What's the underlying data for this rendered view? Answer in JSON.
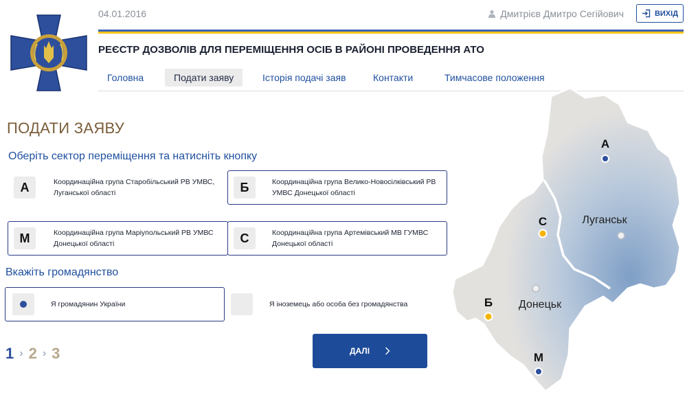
{
  "header": {
    "date": "04.01.2016",
    "user_name": "Дмитрієв Дмитро Сегійович",
    "logout_label": "ВИХІД",
    "registry_title": "РЕЄСТР ДОЗВОЛІВ ДЛЯ ПЕРЕМІЩЕННЯ ОСІБ В РАЙОНІ ПРОВЕДЕННЯ АТО"
  },
  "nav": {
    "items": [
      {
        "label": "Головна",
        "active": false
      },
      {
        "label": "Подати заяву",
        "active": true
      },
      {
        "label": "Історія подачі заяв",
        "active": false
      },
      {
        "label": "Контакти",
        "active": false
      },
      {
        "label": "Тимчасове положення",
        "active": false
      }
    ]
  },
  "main": {
    "page_title": "ПОДАТИ ЗАЯВУ",
    "sector_prompt": "Оберіть сектор переміщення та натисніть кнопку",
    "sectors": [
      {
        "letter": "А",
        "text": "Координаційна група Старобільський РВ УМВС, Луганської області"
      },
      {
        "letter": "Б",
        "text": "Координаційна група Велико-Новосілківський РВ УМВС Донецької області"
      },
      {
        "letter": "М",
        "text": "Координаційна група Маріупольський РВ УМВС Донецької області"
      },
      {
        "letter": "С",
        "text": "Координаційна група Артемівський МВ ГУМВС Донецької області"
      }
    ],
    "citizenship_prompt": "Вкажіть громадянство",
    "citizenship_options": [
      {
        "label": "Я громадянин України",
        "selected": true
      },
      {
        "label": "Я іноземець або особа без громадянства",
        "selected": false
      }
    ],
    "steps": [
      "1",
      "2",
      "3"
    ],
    "next_label": "ДАЛІ"
  },
  "map": {
    "labels": {
      "luhansk": "Луганськ",
      "donetsk": "Донецьк"
    },
    "markers": {
      "a": "А",
      "s": "С",
      "b": "Б",
      "m": "М"
    }
  },
  "colors": {
    "accent_blue": "#1d4b99",
    "flag_blue": "#3d63ae",
    "flag_yellow": "#f5c619",
    "marker_yellow": "#f5b400",
    "title_brown": "#7a5d3a"
  },
  "icons": {
    "logo": "sbu-emblem-icon",
    "user": "user-icon",
    "logout": "logout-icon",
    "next": "chevron-right-icon"
  }
}
